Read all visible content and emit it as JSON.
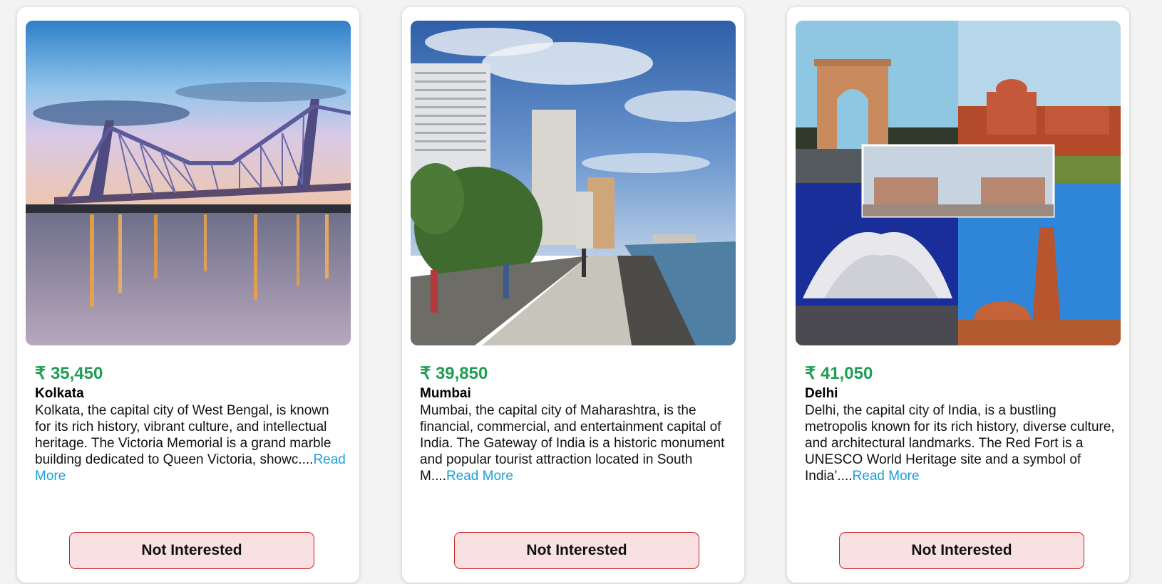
{
  "cards": [
    {
      "price": "₹ 35,450",
      "city": "Kolkata",
      "description": "Kolkata, the capital city of West Bengal, is known for its rich history, vibrant culture, and intellectual heritage. The Victoria Memorial is a grand marble building dedicated to Queen Victoria, showc....",
      "read_more": "Read More",
      "button": "Not Interested",
      "photo_icon": "howrah-bridge-photo"
    },
    {
      "price": "₹ 39,850",
      "city": "Mumbai",
      "description": "Mumbai, the capital city of Maharashtra, is the financial, commercial, and entertainment capital of India. The Gateway of India is a historic monument and popular tourist attraction located in South M....",
      "read_more": "Read More",
      "button": "Not Interested",
      "photo_icon": "marine-drive-photo"
    },
    {
      "price": "₹ 41,050",
      "city": "Delhi",
      "description": "Delhi, the capital city of India, is a bustling metropolis known for its rich history, diverse culture, and architectural landmarks. The Red Fort is a UNESCO World Heritage site and a symbol of India’....",
      "read_more": "Read More",
      "button": "Not Interested",
      "photo_icon": "delhi-collage-photo"
    }
  ],
  "colors": {
    "price": "#1f9d55",
    "link": "#1a9fd9",
    "button_bg": "#f9e0e2",
    "button_border": "#c9242b"
  }
}
